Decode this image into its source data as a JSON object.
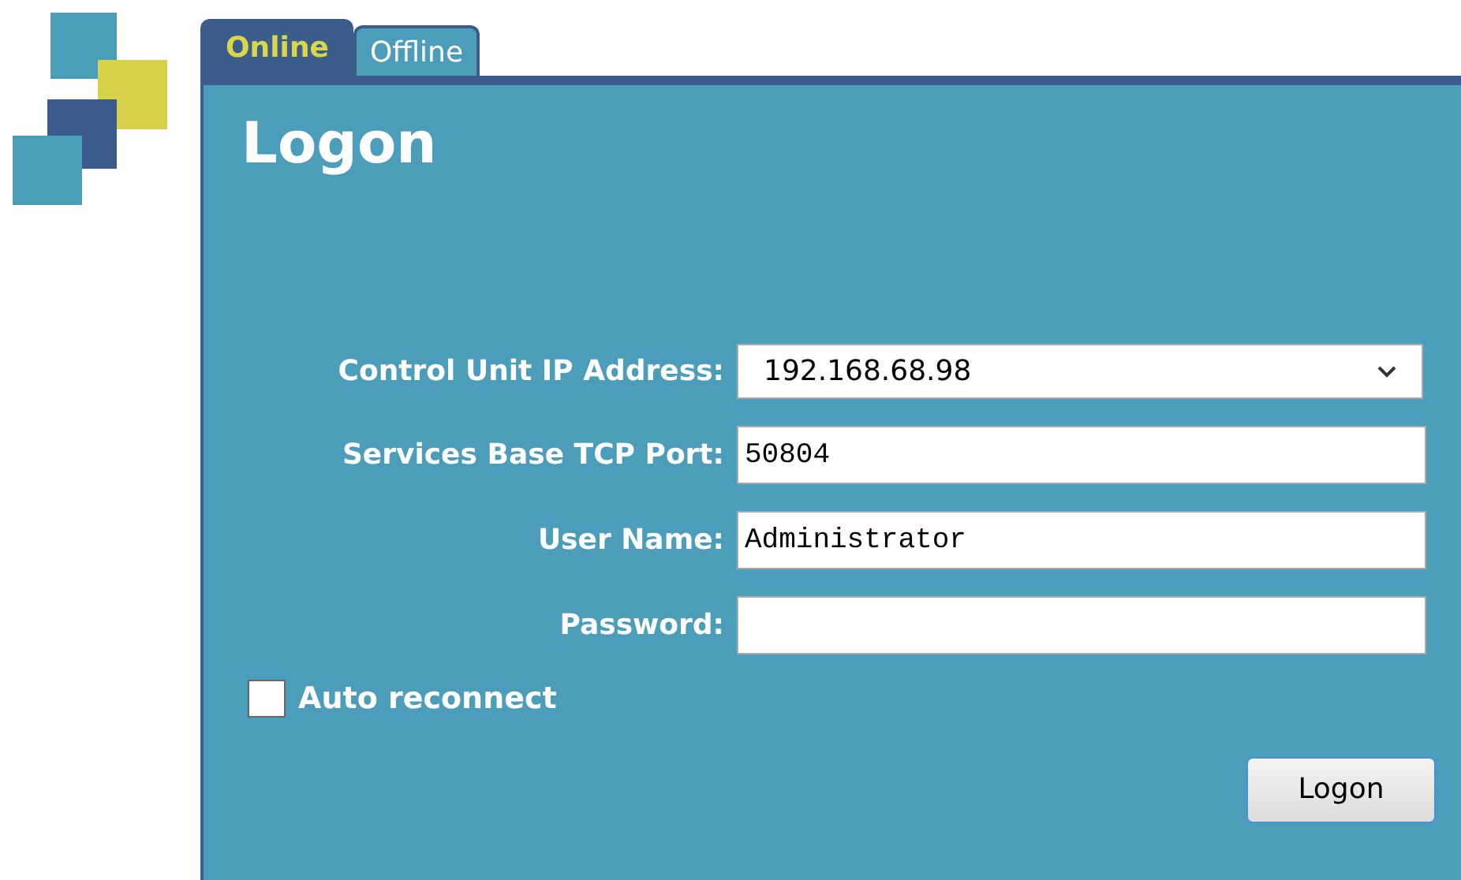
{
  "tabs": [
    {
      "label": "Online",
      "selected": true
    },
    {
      "label": "Offline",
      "selected": false
    }
  ],
  "title": "Logon",
  "fields": [
    {
      "kind": "dropdown",
      "label": "Control Unit IP Address:",
      "value": "192.168.68.98"
    },
    {
      "kind": "text",
      "label": "Services Base TCP Port:",
      "value": "50804"
    },
    {
      "kind": "text",
      "label": "User Name:",
      "value": "Administrator"
    },
    {
      "kind": "password",
      "label": "Password:"
    }
  ],
  "auto_reconnect": {
    "label": "Auto reconnect",
    "checked": false
  },
  "button": "Logon"
}
